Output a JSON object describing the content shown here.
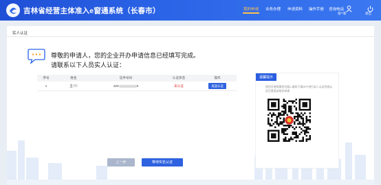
{
  "header": {
    "title": "吉林省经营主体准入e窗通系统（长春市）",
    "nav": [
      "我的申请",
      "业务办理",
      "申请资料",
      "操作手册",
      "咨询电话"
    ],
    "user_label": "张**家",
    "logout_label": "退出"
  },
  "breadcrumb": "实人认证",
  "message": {
    "line1": "尊敬的申请人，您的企业开办申请信息已经填写完成。",
    "line2": "请联系以下人员实人认证："
  },
  "table": {
    "headers": [
      "序号",
      "姓名",
      "证件号码",
      "认证状态",
      "操作"
    ],
    "rows": [
      {
        "index": "1",
        "name": "王",
        "id_prefix": "220",
        "id_suffix": "8",
        "status": "未认证",
        "action": "发送认证"
      }
    ]
  },
  "side_panel": {
    "tag": "温馨提示",
    "text": "您也可使用微信扫描二维码下载APP进行实人认证完成认证后登录自助台申请"
  },
  "buttons": {
    "prev": "上一步",
    "next": "等待实名认证"
  },
  "colors": {
    "header_blue": "#2a63e6",
    "active_nav": "#ffc24a",
    "primary_button": "#2e62e0",
    "status_red": "#e03030"
  }
}
